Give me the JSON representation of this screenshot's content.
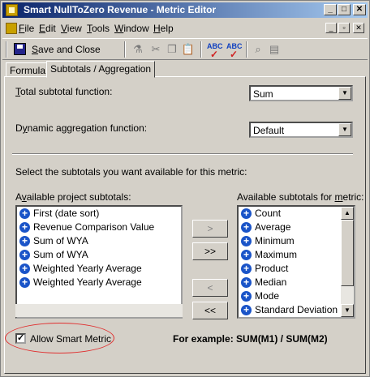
{
  "window": {
    "title": "Smart NullToZero Revenue - Metric Editor",
    "controls": {
      "minimize": "_",
      "maximize": "□",
      "close": "✕"
    }
  },
  "menu": {
    "items": [
      {
        "pre": "",
        "u": "F",
        "post": "ile"
      },
      {
        "pre": "",
        "u": "E",
        "post": "dit"
      },
      {
        "pre": "",
        "u": "V",
        "post": "iew"
      },
      {
        "pre": "",
        "u": "T",
        "post": "ools"
      },
      {
        "pre": "",
        "u": "W",
        "post": "indow"
      },
      {
        "pre": "",
        "u": "H",
        "post": "elp"
      }
    ]
  },
  "toolbar": {
    "save_pre": "",
    "save_u": "S",
    "save_post": "ave and Close",
    "icons": [
      "insert-function-icon",
      "cut-icon",
      "copy-icon",
      "paste-icon",
      "spell-check-icon",
      "spell-check-all-icon",
      "find-icon",
      "template-icon"
    ]
  },
  "tabs": [
    {
      "label": "Formula",
      "active": false
    },
    {
      "label": "Subtotals / Aggregation",
      "active": true
    }
  ],
  "total_subtotal": {
    "label_pre": "",
    "label_u": "T",
    "label_post": "otal subtotal function:",
    "value": "Sum"
  },
  "dynamic_aggregation": {
    "label_pre": "D",
    "label_u": "y",
    "label_post": "namic aggregation function:",
    "value": "Default"
  },
  "instruction": "Select the subtotals you want available for this metric:",
  "available_project": {
    "label_pre": "A",
    "label_u": "v",
    "label_post": "ailable project subtotals:",
    "items": [
      "First (date sort)",
      "Revenue Comparison Value",
      "Sum of WYA",
      "Sum of WYA",
      "Weighted Yearly Average",
      "Weighted Yearly Average"
    ]
  },
  "available_metric": {
    "label_pre": "Available subtotals for ",
    "label_u": "m",
    "label_post": "etric:",
    "items": [
      "Count",
      "Average",
      "Minimum",
      "Maximum",
      "Product",
      "Median",
      "Mode",
      "Standard Deviation"
    ]
  },
  "move_buttons": {
    "add": ">",
    "add_all": ">>",
    "remove": "<",
    "remove_all": "<<"
  },
  "allow_smart": {
    "checked": "✓",
    "label": "Allow Smart Metric"
  },
  "example": "For example: SUM(M1) / SUM(M2)"
}
